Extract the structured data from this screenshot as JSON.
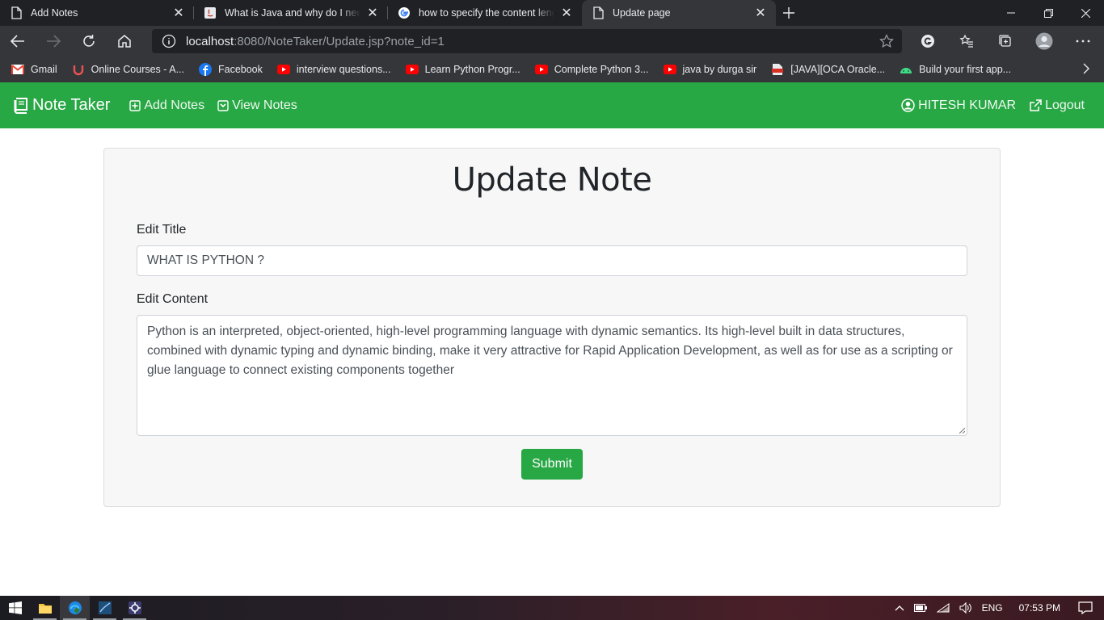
{
  "tabs": [
    {
      "title": "Add Notes",
      "icon": "page-icon",
      "active": false
    },
    {
      "title": "What is Java and why do I need it?",
      "icon": "java-icon",
      "active": false
    },
    {
      "title": "how to specify the content length",
      "icon": "google-icon",
      "active": false
    },
    {
      "title": "Update page",
      "icon": "page-icon",
      "active": true
    }
  ],
  "address": {
    "host": "localhost",
    "path": ":8080/NoteTaker/Update.jsp?note_id=1"
  },
  "bookmarks": [
    {
      "label": "Gmail",
      "icon": "gmail-icon"
    },
    {
      "label": "Online Courses - A...",
      "icon": "udemy-icon"
    },
    {
      "label": "Facebook",
      "icon": "facebook-icon"
    },
    {
      "label": "interview questions...",
      "icon": "youtube-icon"
    },
    {
      "label": "Learn Python Progr...",
      "icon": "youtube-icon"
    },
    {
      "label": "Complete Python 3...",
      "icon": "youtube-icon"
    },
    {
      "label": "java by durga sir",
      "icon": "youtube-icon"
    },
    {
      "label": "[JAVA][OCA Oracle...",
      "icon": "pdf-icon"
    },
    {
      "label": "Build your first app...",
      "icon": "android-icon"
    }
  ],
  "nav": {
    "brand": "Note Taker",
    "add_notes": "Add Notes",
    "view_notes": "View Notes",
    "user": "HITESH KUMAR",
    "logout": "Logout"
  },
  "form": {
    "heading": "Update Note",
    "title_label": "Edit Title",
    "title_value": "WHAT IS PYTHON ?",
    "content_label": "Edit Content",
    "content_value": "Python is an interpreted, object-oriented, high-level programming language with dynamic semantics. Its high-level built in data structures, combined with dynamic typing and dynamic binding, make it very attractive for Rapid Application Development, as well as for use as a scripting or glue language to connect existing components together",
    "submit": "Submit"
  },
  "taskbar": {
    "lang": "ENG",
    "time": "07:53 PM"
  },
  "colors": {
    "brand_green": "#28a745",
    "chrome_dark": "#202124",
    "chrome_mid": "#35363a"
  }
}
